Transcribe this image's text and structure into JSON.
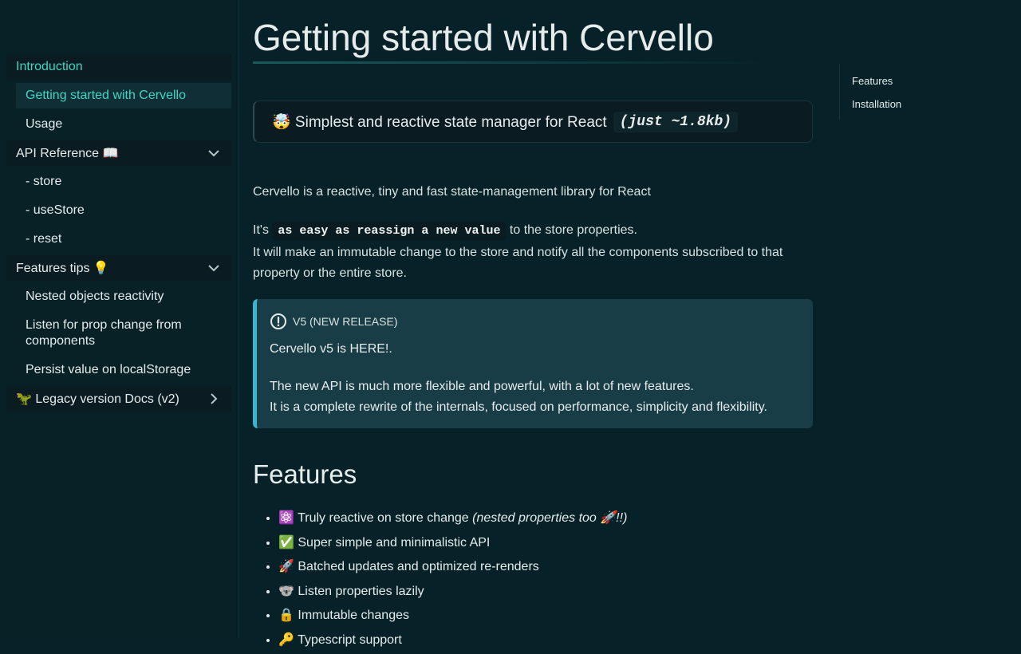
{
  "sidebar": {
    "sections": [
      {
        "label": "Introduction"
      },
      {
        "label": "API Reference 📖"
      },
      {
        "label": "Features tips 💡"
      },
      {
        "label": "🦖 Legacy version Docs (v2)"
      }
    ],
    "intro_items": [
      {
        "label": "Getting started with Cervello"
      },
      {
        "label": "Usage"
      }
    ],
    "api_items": [
      {
        "label": "- store"
      },
      {
        "label": "- useStore"
      },
      {
        "label": "- reset"
      }
    ],
    "tips_items": [
      {
        "label": "Nested objects reactivity"
      },
      {
        "label": "Listen for prop change from components"
      },
      {
        "label": "Persist value on localStorage"
      }
    ]
  },
  "main": {
    "title": "Getting started with Cervello",
    "tagline": {
      "text": "🤯 Simplest and reactive state manager for React",
      "code": "(just ~1.8kb)"
    },
    "intro": "Cervello is a reactive, tiny and fast state-management library for React",
    "p2": {
      "prefix": "It's",
      "code": "as easy as reassign a new value",
      "suffix": "to the store properties.",
      "line2": "It will make an immutable change to the store and notify all the components subscribed to that property or the entire store."
    },
    "callout": {
      "title": "V5 (NEW RELEASE)",
      "line1": "Cervello v5 is HERE!.",
      "line2": "The new API is much more flexible and powerful, with a lot of new features.",
      "line3": "It is a complete rewrite of the internals, focused on performance, simplicity and flexibility."
    },
    "features_heading": "Features",
    "features": [
      {
        "text": "⚛️ Truly reactive on store change",
        "em": "(nested properties too 🚀!!)"
      },
      {
        "text": "✅ Super simple and minimalistic API",
        "em": ""
      },
      {
        "text": "🚀 Batched updates and optimized re-renders",
        "em": ""
      },
      {
        "text": "🐨 Listen properties lazily",
        "em": ""
      },
      {
        "text": "🔒 Immutable changes",
        "em": ""
      },
      {
        "text": "🔑 Typescript support",
        "em": ""
      }
    ]
  },
  "toc": {
    "items": [
      {
        "label": "Features"
      },
      {
        "label": "Installation"
      }
    ]
  },
  "colors": {
    "background": "#062228",
    "accent": "#3fd6c4",
    "callout_border": "#3cb4cf",
    "callout_bg": "#193d47"
  }
}
